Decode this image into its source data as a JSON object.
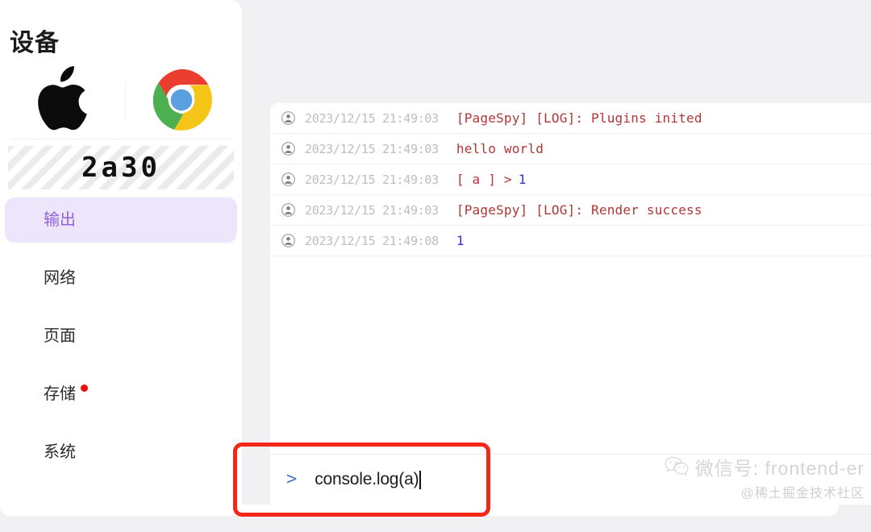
{
  "sidebar": {
    "title": "设备",
    "device_logos": [
      {
        "name": "apple-logo",
        "label": "Apple"
      },
      {
        "name": "chrome-logo",
        "label": "Chrome"
      }
    ],
    "device_id": "2a30",
    "menu": [
      {
        "label": "输出",
        "active": true,
        "badge": false
      },
      {
        "label": "网络",
        "active": false,
        "badge": false
      },
      {
        "label": "页面",
        "active": false,
        "badge": false
      },
      {
        "label": "存储",
        "active": false,
        "badge": true
      },
      {
        "label": "系统",
        "active": false,
        "badge": false
      }
    ]
  },
  "console": {
    "logs": [
      {
        "time": "2023/12/15 21:49:03",
        "message": "[PageSpy] [LOG]: Plugins inited",
        "color": "red"
      },
      {
        "time": "2023/12/15 21:49:03",
        "message": "hello world",
        "color": "red"
      },
      {
        "time": "2023/12/15 21:49:03",
        "message": "[ a ] >",
        "value": "1",
        "color": "red"
      },
      {
        "time": "2023/12/15 21:49:03",
        "message": "[PageSpy] [LOG]: Render success",
        "color": "red"
      },
      {
        "time": "2023/12/15 21:49:08",
        "message": "",
        "value": "1",
        "color": "blue"
      }
    ],
    "prompt_symbol": ">",
    "input_value": "console.log(a)",
    "input_placeholder": ""
  },
  "annotation": {
    "highlight_color": "#f42718"
  },
  "watermark": {
    "line1": "微信号: frontend-er",
    "line2": "@稀土掘金技术社区"
  },
  "colors": {
    "accent_purple": "#9163df",
    "active_bg": "#ede5fa",
    "log_red": "#b13636",
    "log_blue": "#3333cc",
    "badge_red": "#ee0b0b",
    "page_bg": "#f1f1f3"
  }
}
